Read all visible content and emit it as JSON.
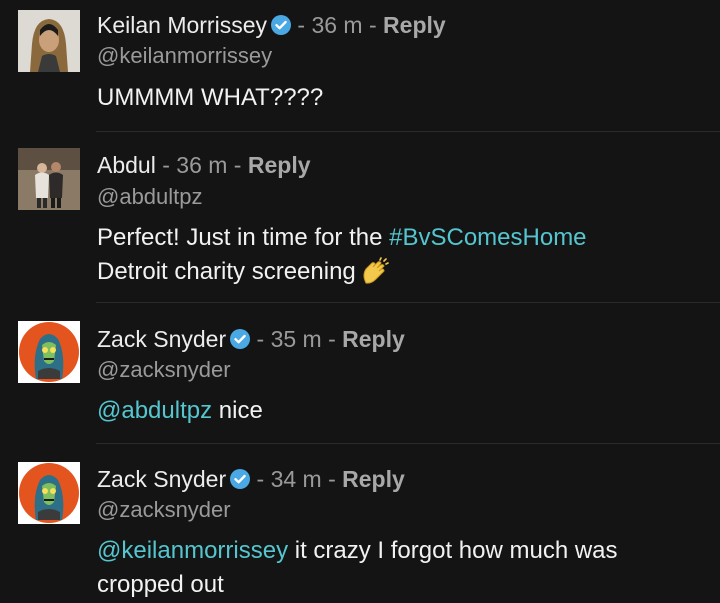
{
  "comments": [
    {
      "name": "Keilan Morrissey",
      "verified": true,
      "separator": " - ",
      "time": "36 m",
      "reply": "Reply",
      "handle": "@keilanmorrissey",
      "text": "UMMMM WHAT????",
      "avatar": "person-long-hair-photo"
    },
    {
      "name": "Abdul",
      "verified": false,
      "separator": " - ",
      "time": "36 m",
      "reply": "Reply",
      "handle": "@abdultpz",
      "text_before": "Perfect! Just in time for the ",
      "hashtag": "#BvSComesHome",
      "text_after": "Detroit charity screening",
      "emoji": "clapping-hands-icon",
      "avatar": "two-people-photo"
    },
    {
      "name": "Zack Snyder",
      "verified": true,
      "separator": " - ",
      "time": "35 m",
      "reply": "Reply",
      "handle": "@zacksnyder",
      "mention": "@abdultpz",
      "text": " nice",
      "avatar": "zombie-illustration"
    },
    {
      "name": "Zack Snyder",
      "verified": true,
      "separator": " - ",
      "time": "34 m",
      "reply": "Reply",
      "handle": "@zacksnyder",
      "mention": "@keilanmorrissey",
      "text": " it crazy I forgot how much was cropped out",
      "avatar": "zombie-illustration"
    }
  ],
  "colors": {
    "background": "#141414",
    "link": "#55c6cf",
    "verified": "#4aa9e4",
    "muted": "#9a9a9a"
  }
}
